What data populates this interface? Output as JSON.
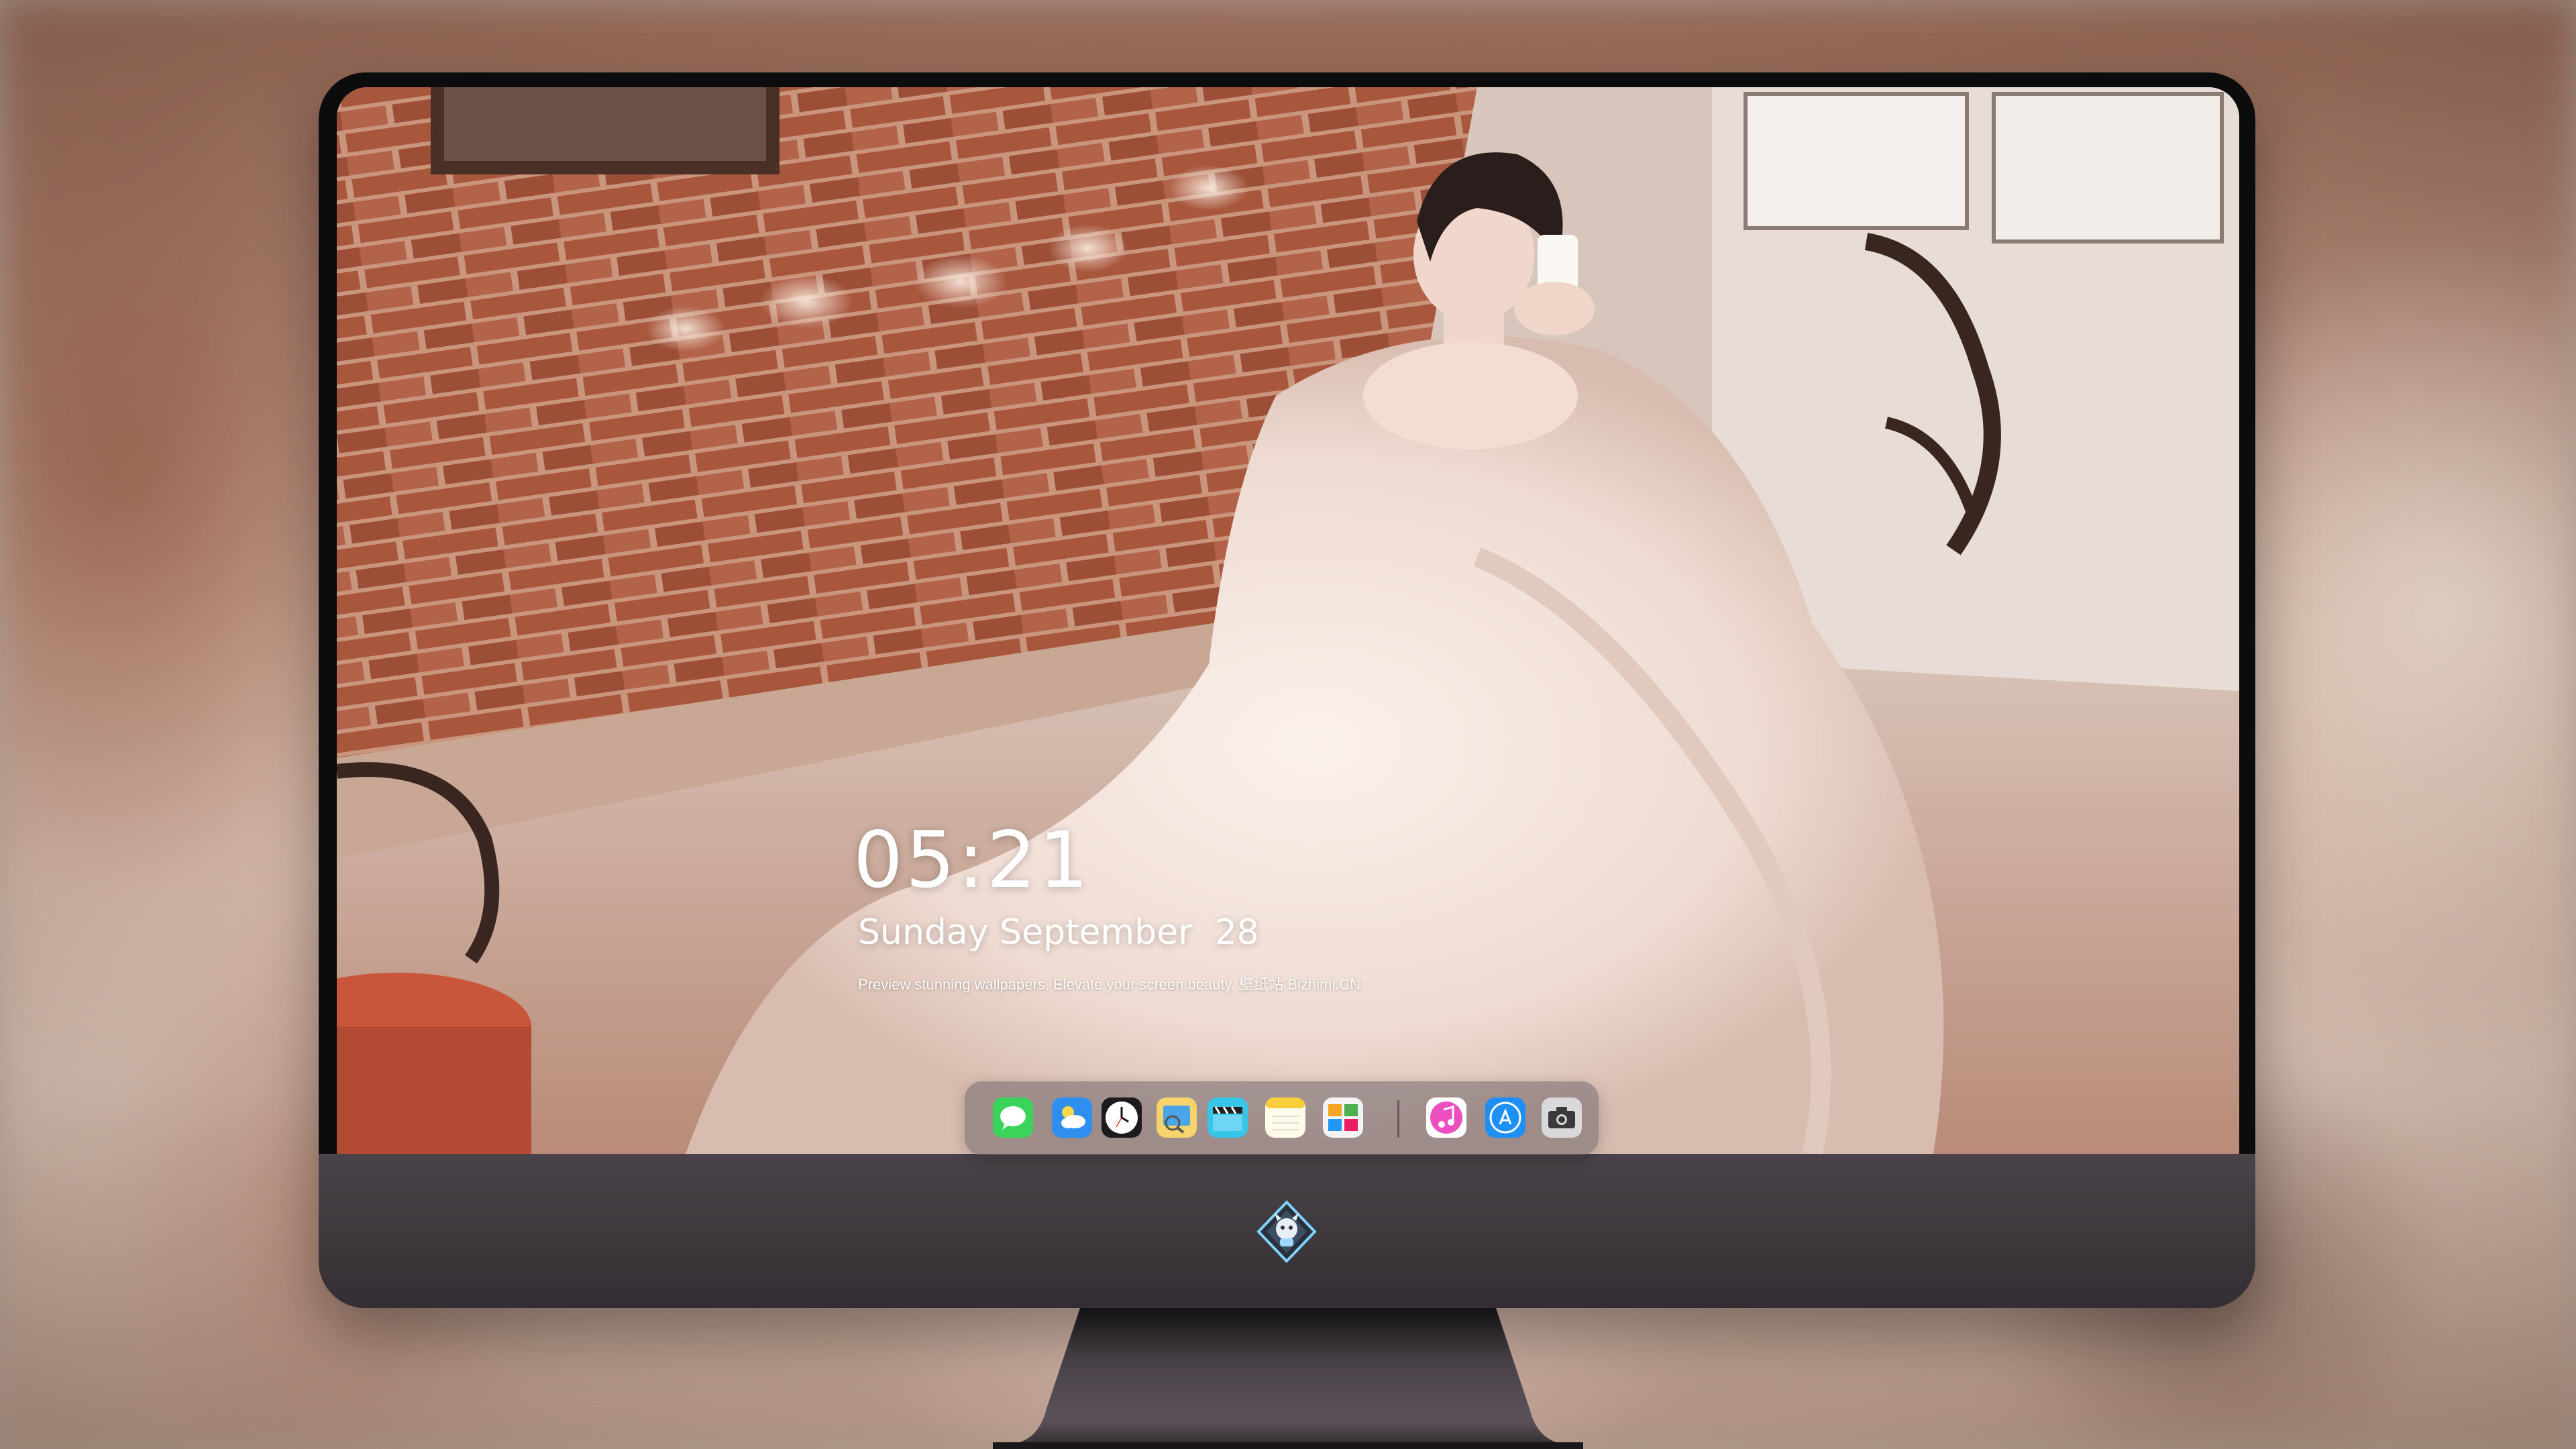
{
  "lockscreen": {
    "time": "05:21",
    "date": "Sunday September  28",
    "tagline": "Preview stunning wallpapers. Elevate your screen beauty. 壁纸站 Bizhimi.CN"
  },
  "dock": {
    "items": [
      {
        "name": "messages-icon",
        "label": "Messages"
      },
      {
        "name": "weather-icon",
        "label": "Weather"
      },
      {
        "name": "clock-icon",
        "label": "Clock"
      },
      {
        "name": "preview-icon",
        "label": "Preview"
      },
      {
        "name": "clapper-icon",
        "label": "Video"
      },
      {
        "name": "notes-icon",
        "label": "Notes"
      },
      {
        "name": "photo-booth-icon",
        "label": "Photos"
      },
      {
        "name": "music-icon",
        "label": "Music"
      },
      {
        "name": "app-store-icon",
        "label": "App Store"
      },
      {
        "name": "camera-icon",
        "label": "Camera"
      }
    ]
  },
  "colors": {
    "bezel": "#0c0c0d",
    "chin": "#3d373c",
    "clock_text": "#ffffff",
    "dock_bg": "rgba(110,100,105,0.55)"
  }
}
